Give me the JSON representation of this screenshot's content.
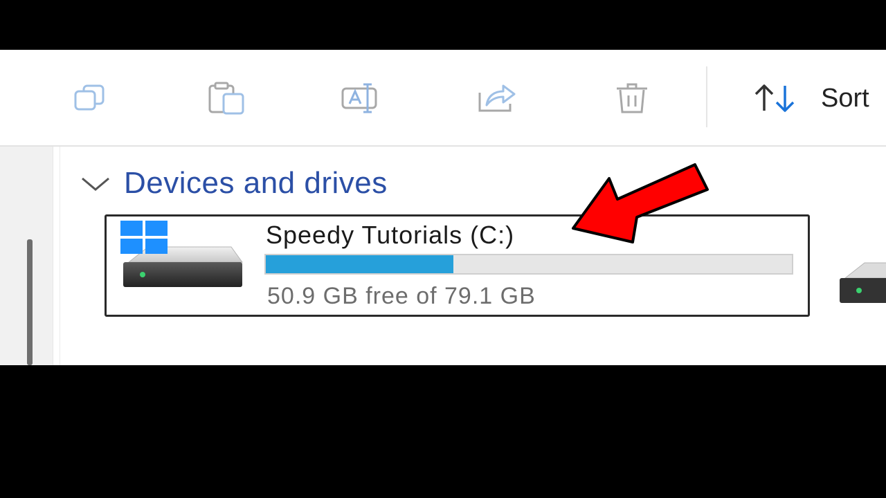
{
  "toolbar": {
    "buttons": [
      {
        "icon": "copy-icon"
      },
      {
        "icon": "paste-icon"
      },
      {
        "icon": "rename-icon"
      },
      {
        "icon": "share-icon"
      },
      {
        "icon": "delete-icon"
      }
    ],
    "sort_label": "Sort",
    "sort_icon": "sort-icon"
  },
  "section": {
    "title": "Devices and drives",
    "chevron_icon": "chevron-down-icon"
  },
  "drives": [
    {
      "name": "Speedy Tutorials (C:)",
      "space_text": "50.9 GB free of 79.1 GB",
      "free_gb": 50.9,
      "total_gb": 79.1,
      "used_fraction": 0.357,
      "icon": "windows-drive-icon"
    }
  ],
  "colors": {
    "accent": "#26a0da",
    "section_title": "#2b4fa6",
    "annotation_arrow": "#ff0000",
    "windows_logo": "#1e90ff"
  }
}
